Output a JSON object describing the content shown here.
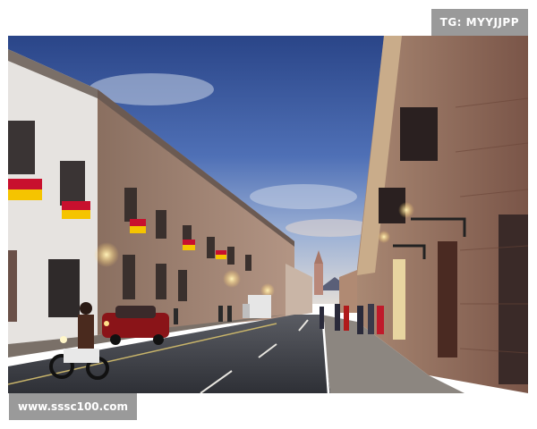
{
  "watermark_top": "TG: MYYJJPP",
  "watermark_bottom": "www.sssc100.com",
  "scene": {
    "sky_colors": [
      "#2c4a8c",
      "#4d6fb5",
      "#8fa8d4",
      "#d9dde6"
    ],
    "building_stone": "#9a7d6a",
    "building_white": "#e8e6e4",
    "road": "#3b3d44",
    "sidewalk": "#8c8680",
    "flag_colors": [
      "#c8102e",
      "#f5c400"
    ],
    "lamp_glow": "#ffcf6b"
  }
}
